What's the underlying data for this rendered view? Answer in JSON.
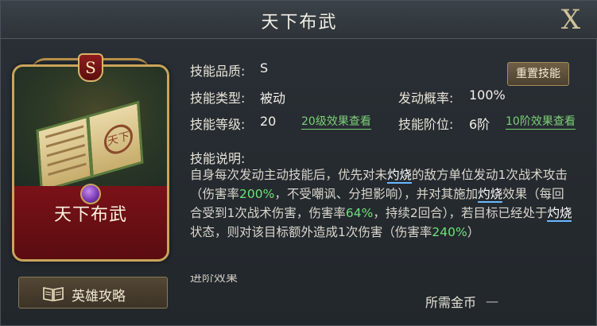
{
  "window": {
    "title": "天下布武",
    "close_label": "X"
  },
  "card": {
    "rank": "S",
    "name": "天下布武",
    "book_seal": "天下"
  },
  "guide_button": {
    "label": "英雄攻略",
    "icon": "book-icon"
  },
  "info": {
    "quality_label": "技能品质:",
    "quality_value": "S",
    "type_label": "技能类型:",
    "type_value": "被动",
    "trigger_label": "发动概率:",
    "trigger_value": "100%",
    "level_label": "技能等级:",
    "level_value": "20",
    "level_link": "20级效果查看",
    "stage_label": "技能阶位:",
    "stage_value": "6阶",
    "stage_link": "10阶效果查看",
    "reset_button": "重置技能"
  },
  "description": {
    "title": "技能说明:",
    "p1": "自身每次发动主动技能后，优先对未",
    "kw1": "灼烧",
    "p2": "的敌方单位发动1次战术攻击（伤害率",
    "n1": "200%",
    "p3": "，不受嘲讽、分担影响），并对其施加",
    "kw2": "灼烧",
    "p4": "效果（每回合受到1次战术伤害，伤害率",
    "n2": "64%",
    "p5": "，持续2回合），若目标已经处于",
    "kw3": "灼烧",
    "p6": "状态，则对该目标额外造成1次伤害（伤害率",
    "n3": "240%",
    "p7": "）"
  },
  "advance_heading": "进阶效果",
  "cost": {
    "label": "所需金币",
    "value": "一"
  },
  "colors": {
    "highlight_green": "#6ee07a",
    "keyword_underline": "#6ab8ff",
    "card_frame_gold": "#c9a45a",
    "card_red": "#7a1218"
  }
}
